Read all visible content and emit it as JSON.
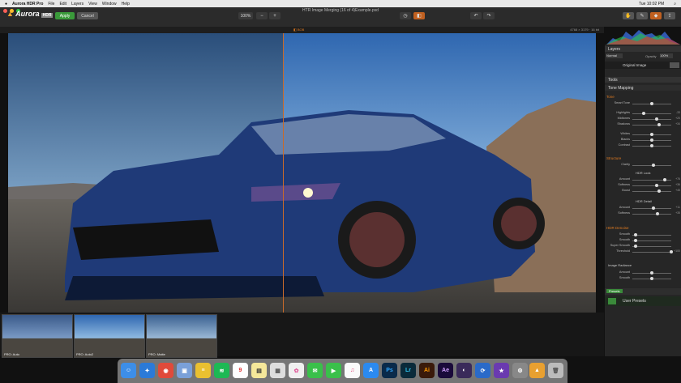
{
  "menubar": {
    "app": "Aurora HDR Pro",
    "items": [
      "File",
      "Edit",
      "Layers",
      "View",
      "Window",
      "Help"
    ],
    "clock": "Tue 10:02 PM"
  },
  "toolbar": {
    "logo_main": "Aurora",
    "logo_badge": "HDR",
    "apply_label": "Apply",
    "cancel_label": "Cancel",
    "doc_title": "HTR Image Merging (16 of 4)Example.psd",
    "zoom_label": "100%",
    "split_label": "◧"
  },
  "canvas": {
    "bar_center": "◧ BOB",
    "bar_right": "4768 × 3179 · 16 bit"
  },
  "panel": {
    "layers_label": "Layers",
    "blend_label": "Normal",
    "opacity_label": "Opacity",
    "opacity_value": "100%",
    "layer_name": "Original Image",
    "tools_label": "Tools",
    "tone_mapping_label": "Tone Mapping",
    "tone_label": "Tone",
    "smart_tone_label": "Smart Tone",
    "highlights_label": "Highlights",
    "highlights_value": "-33",
    "midtones_label": "Midtones",
    "midtones_value": "+20",
    "shadows_label": "Shadows",
    "shadows_value": "+34",
    "whites_label": "Whites",
    "blacks_label": "Blacks",
    "contrast_label": "Contrast",
    "structure_label": "Structure",
    "clarity_label": "Clarity",
    "hdr_look_label": "HDR Look",
    "amount_label": "Amount",
    "amount_value": "+76",
    "softness_label": "Softness",
    "softness_value": "+36",
    "boost_label": "Boost",
    "boost_value": "+45",
    "hdr_detail_label": "HDR Detail",
    "detail_amount_value": "+11",
    "detail_softness_value": "+35",
    "denoise_label": "HDR Denoise",
    "denoise_smooth_label": "Smooth",
    "denoise_smooth2_label": "Smooth",
    "super_smooth_label": "Super Smooth",
    "threshold_label": "Threshold",
    "threshold_value": "+100",
    "radiance_label": "Image Radiance",
    "radiance_amount_label": "Amount",
    "radiance_smooth_label": "Smooth",
    "presets_label": "Presets",
    "user_presets_label": "User Presets"
  },
  "filmstrip": {
    "thumbs": [
      "PRO: Auto",
      "PRO: Auto2",
      "PRO: Matte"
    ]
  },
  "dock": {
    "icons": [
      "finder-icon",
      "safari-icon",
      "chrome-icon",
      "preview-icon",
      "spotify-icon",
      "calendar-icon",
      "notes-icon",
      "photos-icon",
      "messages-icon",
      "facetime-icon",
      "itunes-icon",
      "appstore-icon",
      "photoshop-icon",
      "lightroom-icon",
      "illustrator-icon",
      "aftereffects-icon",
      "settings-icon",
      "compass-icon",
      "aurora-icon",
      "trash-icon"
    ],
    "ps": "Ps",
    "lr": "Lr",
    "ai": "Ai",
    "ae": "Ae",
    "cal": "9"
  }
}
